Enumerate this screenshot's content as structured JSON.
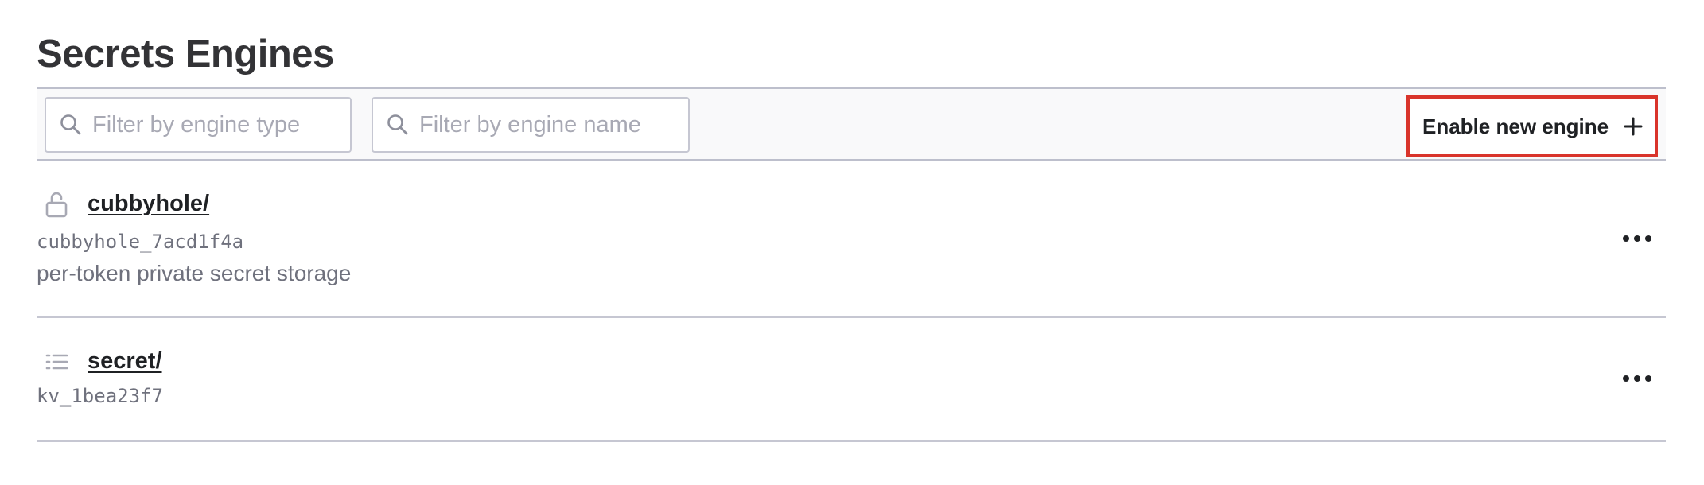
{
  "page": {
    "title": "Secrets Engines"
  },
  "toolbar": {
    "filter_type": {
      "placeholder": "Filter by engine type",
      "value": ""
    },
    "filter_name": {
      "placeholder": "Filter by engine name",
      "value": ""
    },
    "enable_button_label": "Enable new engine",
    "highlight_color": "#d9342b"
  },
  "engines": [
    {
      "path": "cubbyhole/",
      "accessor": "cubbyhole_7acd1f4a",
      "description": "per-token private secret storage",
      "icon": "lock-open-icon"
    },
    {
      "path": "secret/",
      "accessor": "kv_1bea23f7",
      "description": "",
      "icon": "list-icon"
    }
  ],
  "colors": {
    "accent_highlight": "#d9342b",
    "muted_text": "#6f717d",
    "toolbar_bg": "#f9f9fa"
  }
}
